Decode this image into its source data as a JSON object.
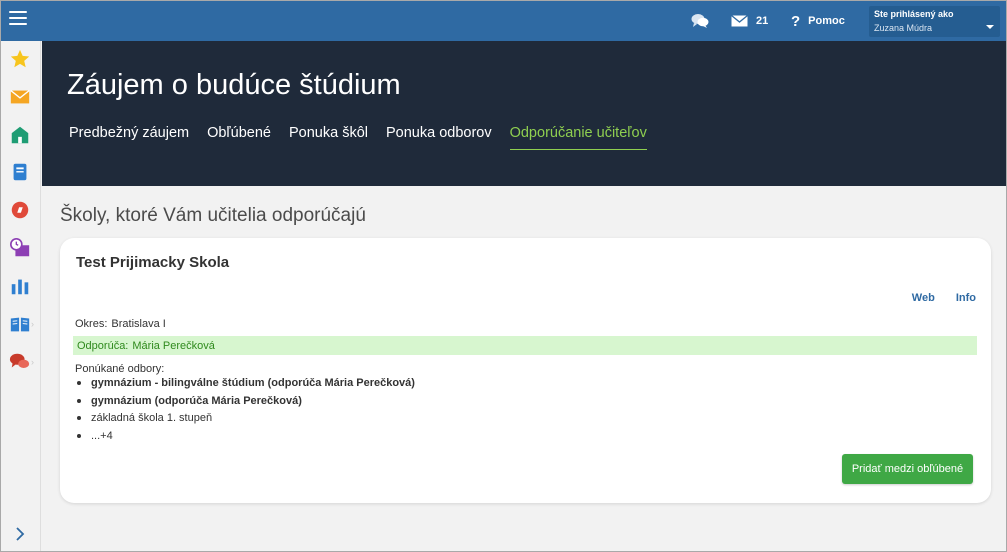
{
  "topbar": {
    "mail_count": "21",
    "help_label": "Pomoc",
    "user_label": "Ste prihlásený ako",
    "user_name": "Zuzana Múdra"
  },
  "sidebar": {
    "items": [
      {
        "icon": "star-icon",
        "color": "#f7c51e"
      },
      {
        "icon": "envelope-icon",
        "color": "#f5a623"
      },
      {
        "icon": "school-icon",
        "color": "#1f9d74"
      },
      {
        "icon": "notebook-icon",
        "color": "#2f7fd0"
      },
      {
        "icon": "compass-icon",
        "color": "#e04a3a"
      },
      {
        "icon": "schedule-icon",
        "color": "#8d3fb4"
      },
      {
        "icon": "chart-icon",
        "color": "#2f7fd0"
      },
      {
        "icon": "book-icon",
        "color": "#2f7fd0"
      },
      {
        "icon": "speech-bubbles-icon",
        "color": "#c83b2b"
      }
    ]
  },
  "header": {
    "title": "Záujem o budúce štúdium",
    "tabs": [
      {
        "label": "Predbežný záujem",
        "active": false
      },
      {
        "label": "Obľúbené",
        "active": false
      },
      {
        "label": "Ponuka škôl",
        "active": false
      },
      {
        "label": "Ponuka odborov",
        "active": false
      },
      {
        "label": "Odporúčanie učiteľov",
        "active": true
      }
    ]
  },
  "main": {
    "section_title": "Školy, ktoré Vám učitelia odporúčajú",
    "card": {
      "title": "Test Prijimacky Skola",
      "web_link": "Web",
      "info_link": "Info",
      "okres_label": "Okres:",
      "okres_value": "Bratislava I",
      "recommend_label": "Odporúča:",
      "recommend_value": "Mária Perečková",
      "fields_label": "Ponúkané odbory:",
      "fields": [
        {
          "text": "gymnázium - bilingválne štúdium (odporúča Mária Perečková)",
          "bold": true
        },
        {
          "text": "gymnázium (odporúča Mária Perečková)",
          "bold": true
        },
        {
          "text": "základná škola 1. stupeň",
          "bold": false
        },
        {
          "text": "...+4",
          "bold": false
        }
      ],
      "add_button": "Pridať medzi obľúbené"
    }
  },
  "colors": {
    "topbar": "#2f6aa3",
    "header": "#1f2a3a",
    "active_tab": "#8fcf50",
    "recommend_bg": "#d7f6cf",
    "button": "#3fa845"
  }
}
